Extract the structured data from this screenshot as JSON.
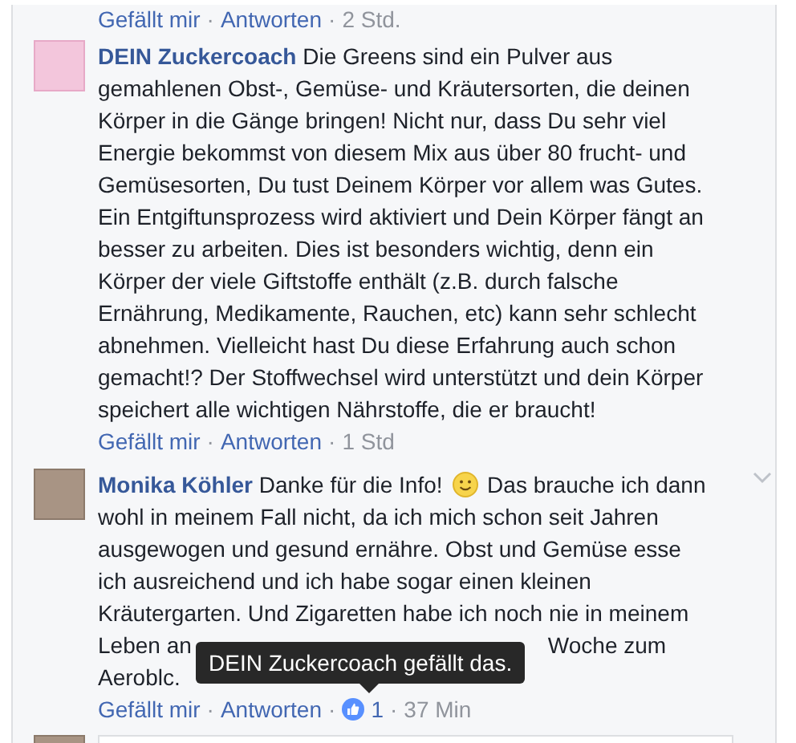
{
  "previous_actions": {
    "like": "Gefällt mir",
    "separator": "·",
    "reply": "Antworten",
    "time": "2 Std."
  },
  "comments": [
    {
      "author": "DEIN Zuckercoach",
      "has_menu": false,
      "parts": [
        {
          "kind": "text",
          "text": "Die Greens sind ein Pulver aus\ngemahlenen Obst-, Gemüse- und Kräutersorten, die deinen\nKörper in die Gänge bringen! Nicht nur, dass Du sehr viel\nEnergie bekommst von diesem Mix aus über 80 frucht- und\nGemüsesorten, Du tust Deinem Körper vor allem was Gutes.\nEin Entgiftunsprozess wird aktiviert und Dein Körper fängt an\nbesser zu arbeiten. Dies ist besonders wichtig, denn ein\nKörper der viele Giftstoffe enthält (z.B. durch falsche\nErnährung, Medikamente, Rauchen, etc) kann sehr schlecht\nabnehmen. Vielleicht hast Du diese Erfahrung auch schon\ngemacht!? Der Stoffwechsel wird unterstützt und dein Körper\nspeichert alle wichtigen Nährstoffe, die er braucht!"
        }
      ],
      "actions": {
        "like": "Gefällt mir",
        "separator": "·",
        "reply": "Antworten",
        "time": "1 Std"
      }
    },
    {
      "author": "Monika Köhler",
      "has_menu": true,
      "parts": [
        {
          "kind": "text",
          "text": "Danke für die Info!"
        },
        {
          "kind": "emoji"
        },
        {
          "kind": "text",
          "text": "Das brauche ich dann\nwohl in meinem Fall nicht, da ich mich schon seit Jahren\nausgewogen und gesund ernähre. Obst und Gemüse esse\nich ausreichend und ich habe sogar einen kleinen\nKräutergarten. Und Zigaretten habe ich noch nie in meinem"
        }
      ],
      "extra_lines": [
        [
          "Leben an",
          "Woche zum"
        ],
        [
          "Aeroblc."
        ]
      ],
      "actions": {
        "like": "Gefällt mir",
        "separator": "·",
        "reply": "Antworten",
        "likes": "1",
        "time": "37 Min"
      }
    }
  ],
  "tooltip": "DEIN Zuckercoach gefällt das."
}
